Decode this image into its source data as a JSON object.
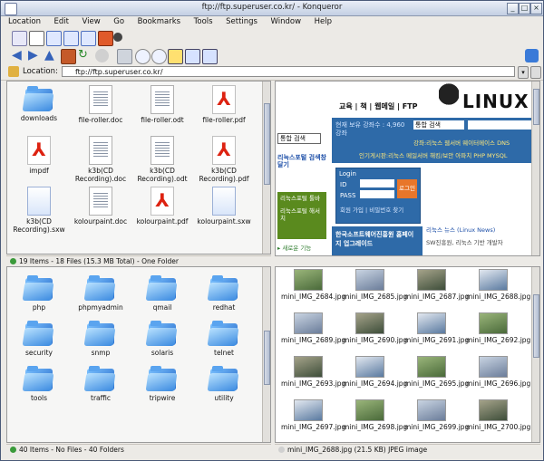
{
  "window": {
    "title": "ftp://ftp.superuser.co.kr/ - Konqueror"
  },
  "menu": [
    "Location",
    "Edit",
    "View",
    "Go",
    "Bookmarks",
    "Tools",
    "Settings",
    "Window",
    "Help"
  ],
  "location": {
    "label": "Location:",
    "url": "ftp://ftp.superuser.co.kr/"
  },
  "top_left": {
    "items": [
      {
        "name": "downloads",
        "type": "folder"
      },
      {
        "name": "file-roller.doc",
        "type": "doc"
      },
      {
        "name": "file-roller.odt",
        "type": "doc"
      },
      {
        "name": "file-roller.pdf",
        "type": "pdf"
      },
      {
        "name": "impdf",
        "type": "pdf"
      },
      {
        "name": "k3b(CD Recording).doc",
        "type": "doc"
      },
      {
        "name": "k3b(CD Recording).odt",
        "type": "doc"
      },
      {
        "name": "k3b(CD Recording).pdf",
        "type": "pdf"
      },
      {
        "name": "k3b(CD Recording).sxw",
        "type": "sxw"
      },
      {
        "name": "kolourpaint.doc",
        "type": "doc"
      },
      {
        "name": "kolourpaint.pdf",
        "type": "pdf"
      },
      {
        "name": "kolourpaint.sxw",
        "type": "sxw"
      }
    ],
    "status": "19 Items - 18 Files (15.3 MB Total) - One Folder"
  },
  "bottom_left": {
    "items": [
      "php",
      "phpmyadmin",
      "qmail",
      "redhat",
      "security",
      "snmp",
      "solaris",
      "telnet",
      "tools",
      "traffic",
      "tripwire",
      "utility"
    ],
    "status": "40 Items - No Files - 40 Folders"
  },
  "web": {
    "nav": [
      "교육",
      "책",
      "웹메일",
      "FTP"
    ],
    "logo": "LINUX",
    "search_select": "통합 검색",
    "stat_line": "현재 보유 강좌수 : 4,960 강좌",
    "news_line": "강좌:리눅스 웹서버 웨이터메이스 DNS",
    "popular": "인기게시판:리눅스 메일서버 해킹/보안 아파치 PHP MYSQL",
    "login_title": "Login",
    "id_label": "ID",
    "pass_label": "PASS",
    "login_button": "로그인",
    "join_links": "회원 가입 | 비밀번호 찾기",
    "portal_select": "통합 검색",
    "portal_text": "리눅스포털 검색창 달기",
    "toolbar_promo": "리눅스포털 툴바",
    "toolbar_sub": "리눅스포털 해서치",
    "new_feature": "▸ 새로운 기능",
    "banner": "한국소프트웨어진흥원 홈페이지 업그레이드",
    "linux_news": "리눅스 뉴스 (Linux News)",
    "news_item": "SW진흥원, 리눅스 기반 개발자"
  },
  "bottom_right": {
    "rows": [
      [
        "mini_IMG_2684.jpg",
        "mini_IMG_2685.jpg",
        "mini_IMG_2687.jpg",
        "mini_IMG_2688.jpg"
      ],
      [
        "mini_IMG_2689.jpg",
        "mini_IMG_2690.jpg",
        "mini_IMG_2691.jpg",
        "mini_IMG_2692.jpg"
      ],
      [
        "mini_IMG_2693.jpg",
        "mini_IMG_2694.jpg",
        "mini_IMG_2695.jpg",
        "mini_IMG_2696.jpg"
      ],
      [
        "mini_IMG_2697.jpg",
        "mini_IMG_2698.jpg",
        "mini_IMG_2699.jpg",
        "mini_IMG_2700.jpg"
      ]
    ],
    "status": "mini_IMG_2688.jpg (21.5 KB)  JPEG image"
  },
  "colors": {
    "accent": "#2a6fd6",
    "status_green": "#3a9a3a",
    "status_red": "#c83a3a"
  }
}
